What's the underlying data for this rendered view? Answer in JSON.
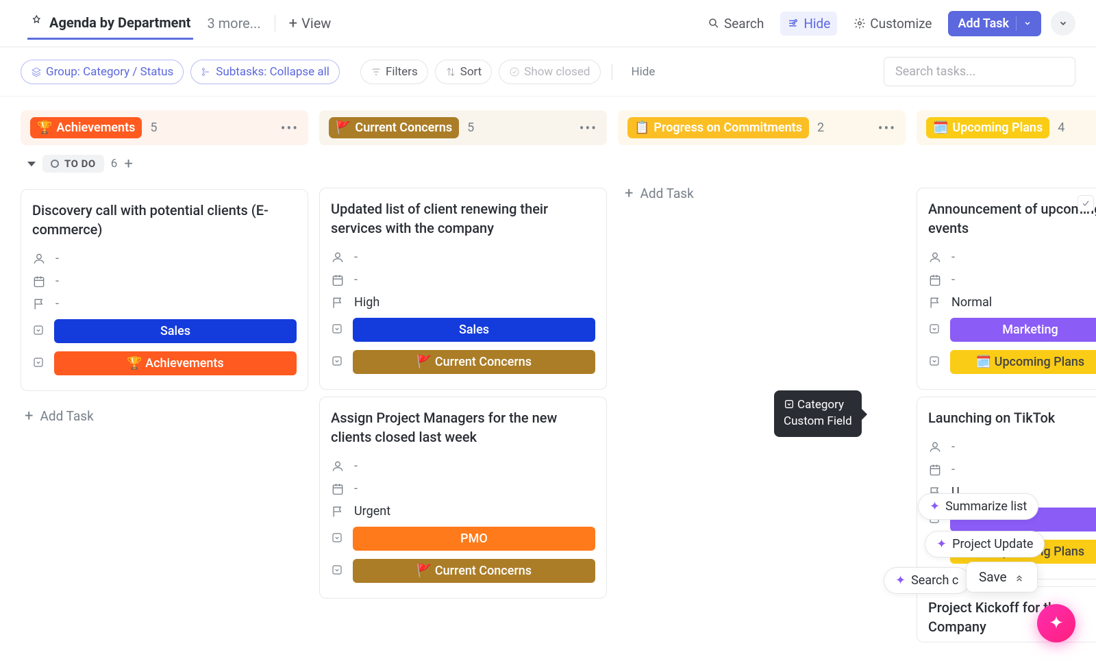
{
  "header": {
    "active_view": "Agenda by Department",
    "more_tabs": "3 more...",
    "view_label": "View",
    "search": "Search",
    "hide": "Hide",
    "customize": "Customize",
    "add_task": "Add Task"
  },
  "toolbar": {
    "group": "Group: Category / Status",
    "subtasks": "Subtasks: Collapse all",
    "filters": "Filters",
    "sort": "Sort",
    "show_closed": "Show closed",
    "hide": "Hide",
    "search_placeholder": "Search tasks..."
  },
  "tooltip": {
    "line1": "Category",
    "line2": "Custom Field"
  },
  "status": {
    "label": "TO DO",
    "count": "6"
  },
  "ai": {
    "summarize": "Summarize list",
    "project_update": "Project Update",
    "search": "Search c",
    "save": "Save"
  },
  "columns": [
    {
      "tag_emoji": "🏆",
      "tag": "Achievements",
      "count": "5",
      "header_class": "col-ach",
      "tag_class": "tag-ach",
      "cards": [
        {
          "title": "Discovery call with potential clients (E-commerce)",
          "assignee": "-",
          "date": "-",
          "priority": "-",
          "flag": "",
          "dept": {
            "text": "Sales",
            "cls": "b-sales"
          },
          "cat": {
            "text": "🏆 Achievements",
            "cls": "b-ach"
          }
        }
      ],
      "add_task": "Add Task"
    },
    {
      "tag_emoji": "🚩",
      "tag": "Current Concerns",
      "count": "5",
      "header_class": "col-conc",
      "tag_class": "tag-conc",
      "cards": [
        {
          "title": "Updated list of client renewing their services with the company",
          "assignee": "-",
          "date": "-",
          "priority": "High",
          "flag": "flag-y",
          "dept": {
            "text": "Sales",
            "cls": "b-sales"
          },
          "cat": {
            "text": "🚩 Current Concerns",
            "cls": "b-conc"
          }
        },
        {
          "title": "Assign Project Managers for the new clients closed last week",
          "assignee": "-",
          "date": "-",
          "priority": "Urgent",
          "flag": "flag-r",
          "dept": {
            "text": "PMO",
            "cls": "b-pmo"
          },
          "cat": {
            "text": "🚩 Current Concerns",
            "cls": "b-conc"
          }
        }
      ]
    },
    {
      "tag_emoji": "📋",
      "tag": "Progress on Commitments",
      "count": "2",
      "header_class": "col-prog",
      "tag_class": "tag-prog",
      "cards": [],
      "add_task_inline": "Add Task"
    },
    {
      "tag_emoji": "🗓️",
      "tag": "Upcoming Plans",
      "count": "4",
      "header_class": "col-plans",
      "tag_class": "tag-plans",
      "cards": [
        {
          "title": "Announcement of upcoming events",
          "assignee": "-",
          "date": "-",
          "priority": "Normal",
          "flag": "flag-b",
          "dept": {
            "text": "Marketing",
            "cls": "b-mkt"
          },
          "cat": {
            "text": "🗓️ Upcoming Plans",
            "cls": "b-plans"
          },
          "show_actions": true
        },
        {
          "title": "Launching on TikTok",
          "assignee": "-",
          "date": "-",
          "priority": "U",
          "flag": "flag-r",
          "dept": {
            "text": "",
            "cls": "b-mkt"
          },
          "cat": {
            "text": "🗓️ Upcoming Plans",
            "cls": "b-plans"
          }
        },
        {
          "title": "Project Kickoff for the Company"
        }
      ]
    }
  ]
}
